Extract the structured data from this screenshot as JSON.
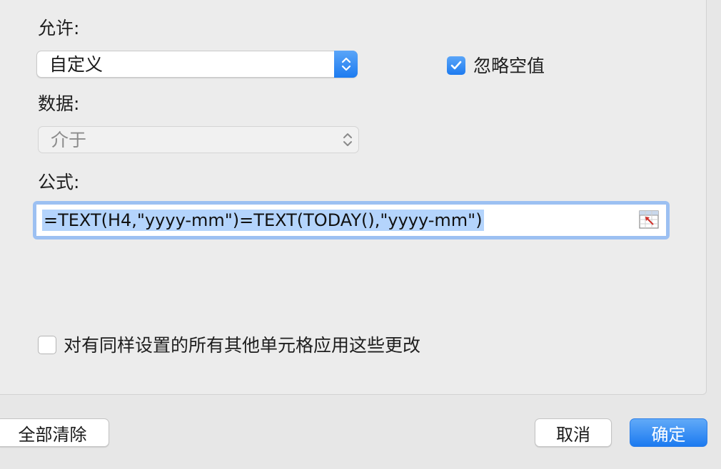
{
  "section_top_label_fragment": "·",
  "allow": {
    "label": "允许:",
    "value": "自定义"
  },
  "ignore_blank": {
    "label": "忽略空值",
    "checked": true
  },
  "data": {
    "label": "数据:",
    "value": "介于"
  },
  "formula": {
    "label": "公式:",
    "value": "=TEXT(H4,\"yyyy-mm\")=TEXT(TODAY(),\"yyyy-mm\")"
  },
  "apply_all": {
    "label": "对有同样设置的所有其他单元格应用这些更改",
    "checked": false
  },
  "buttons": {
    "clear_all": "全部清除",
    "cancel": "取消",
    "ok": "确定"
  },
  "colors": {
    "accent": "#1d7bf0",
    "selection": "#b4d4fc",
    "focus_ring": "#9cc0f2"
  }
}
